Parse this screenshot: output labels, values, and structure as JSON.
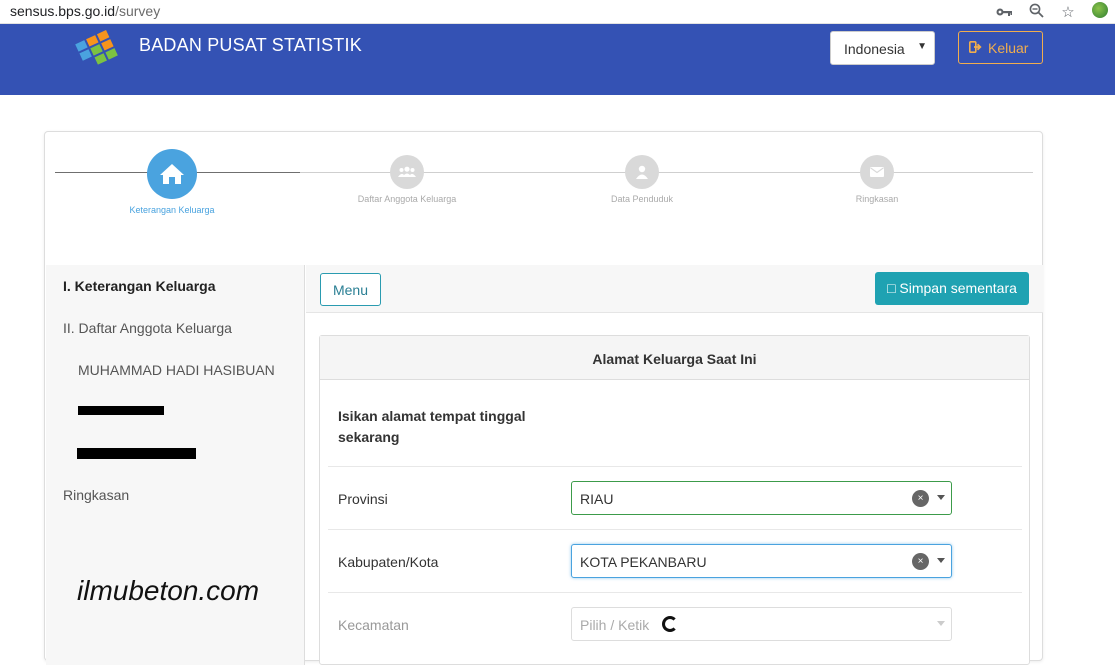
{
  "browser": {
    "url_host": "sensus.bps.go.id",
    "url_path": "/survey"
  },
  "header": {
    "brand": "BADAN PUSAT STATISTIK",
    "language_selected": "Indonesia",
    "logout_label": "Keluar",
    "colors": {
      "bar": "#3452b4",
      "logout": "#f0ad4e"
    }
  },
  "wizard": {
    "steps": [
      {
        "label": "Keterangan Keluarga",
        "icon": "home-icon",
        "active": true
      },
      {
        "label": "Daftar Anggota Keluarga",
        "icon": "users-icon",
        "active": false
      },
      {
        "label": "Data Penduduk",
        "icon": "user-icon",
        "active": false
      },
      {
        "label": "Ringkasan",
        "icon": "envelope-icon",
        "active": false
      }
    ]
  },
  "sidebar": {
    "items": [
      {
        "label": "I. Keterangan Keluarga"
      },
      {
        "label": "II. Daftar Anggota Keluarga"
      },
      {
        "label": "MUHAMMAD HADI HASIBUAN"
      },
      {
        "label": "Ringkasan"
      }
    ],
    "watermark": "ilmubeton.com"
  },
  "toolbar": {
    "menu_label": "Menu",
    "save_label": "□ Simpan sementara"
  },
  "form": {
    "title": "Alamat Keluarga Saat Ini",
    "intro": "Isikan alamat tempat tinggal sekarang",
    "fields": [
      {
        "label": "Provinsi",
        "value": "RIAU"
      },
      {
        "label": "Kabupaten/Kota",
        "value": "KOTA PEKANBARU"
      },
      {
        "label": "Kecamatan",
        "placeholder": "Pilih / Ketik"
      }
    ]
  }
}
